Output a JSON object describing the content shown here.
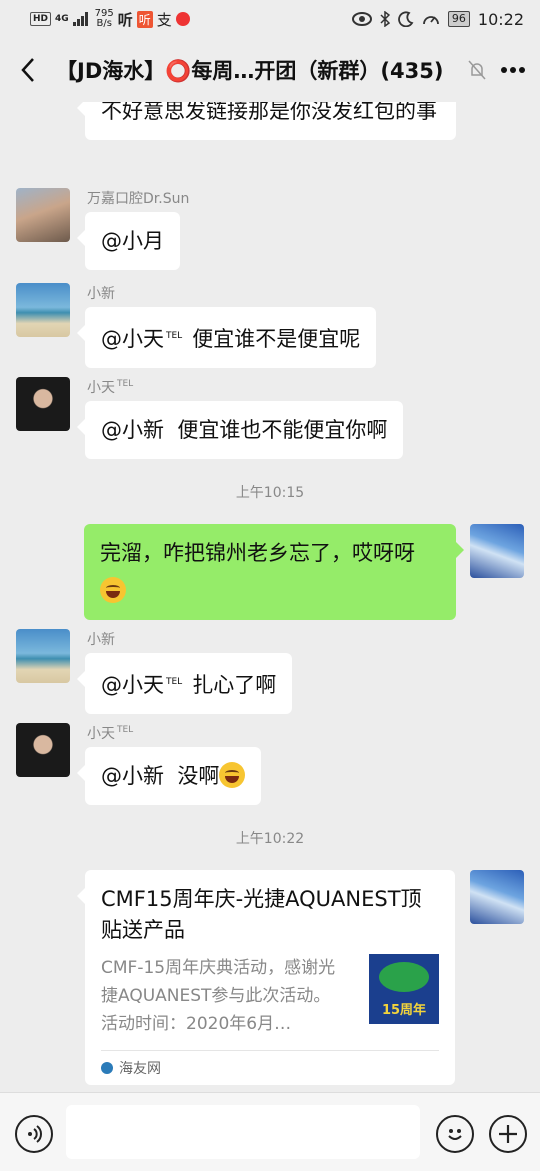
{
  "status_bar": {
    "network_badge": "HD",
    "signal": "4G",
    "speed_value": "795",
    "speed_unit": "B/s",
    "battery": "96",
    "time": "10:22"
  },
  "header": {
    "title": "【JD海水】⭕每周…开团（新群）(435)"
  },
  "messages": [
    {
      "text": "不好意思发链接那是你没发红包的事"
    },
    {
      "sender": "万嘉口腔Dr.Sun",
      "text": "@小月"
    },
    {
      "sender": "小新",
      "text_a": "@小天",
      "sup": "TEL",
      "text_b": "便宜谁不是便宜呢"
    },
    {
      "sender": "小天",
      "sender_sup": "TEL",
      "text": "@小新  便宜谁也不能便宜你啊"
    },
    {
      "text": "完溜，咋把锦州老乡忘了，哎呀呀"
    },
    {
      "sender": "小新",
      "text_a": "@小天",
      "sup": "TEL",
      "text_b": "扎心了啊"
    },
    {
      "sender": "小天",
      "sender_sup": "TEL",
      "text": "@小新  没啊"
    }
  ],
  "timestamps": [
    "上午10:15",
    "上午10:22"
  ],
  "card": {
    "title": "CMF15周年庆-光捷AQUANEST顶贴送产品",
    "description": "CMF-15周年庆典活动，感谢光捷AQUANEST参与此次活动。活动时间：2020年6月…",
    "thumb_text": "15周年",
    "source": "海友网"
  },
  "colors": {
    "background": "#ededed",
    "own_bubble": "#95ec69",
    "other_bubble": "#ffffff"
  }
}
